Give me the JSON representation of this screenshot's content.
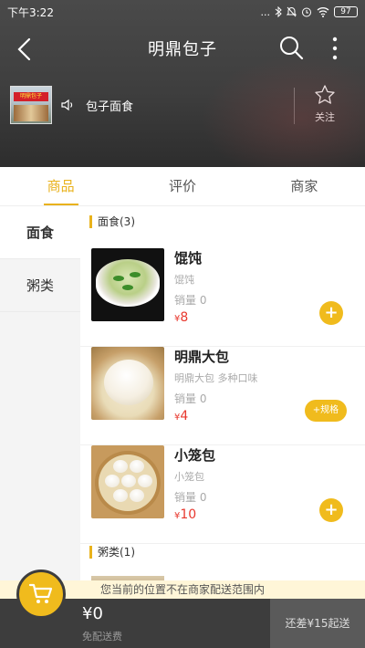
{
  "status_bar": {
    "time": "下午3:22",
    "signal": "...",
    "battery": "97"
  },
  "navbar": {
    "title": "明鼎包子"
  },
  "store": {
    "sign_text": "明鼎包子",
    "notice": "包子面食",
    "follow_label": "关注"
  },
  "tabs": [
    {
      "label": "商品",
      "active": true
    },
    {
      "label": "评价",
      "active": false
    },
    {
      "label": "商家",
      "active": false
    }
  ],
  "categories": [
    {
      "label": "面食",
      "active": true
    },
    {
      "label": "粥类",
      "active": false
    }
  ],
  "sections": [
    {
      "title": "面食(3)"
    },
    {
      "title": "粥类(1)"
    }
  ],
  "products": [
    {
      "name": "馄饨",
      "desc": "馄饨",
      "sales": "销量 0",
      "currency": "¥",
      "price": "8",
      "action": "+"
    },
    {
      "name": "明鼎大包",
      "desc": "明鼎大包  多种口味",
      "sales": "销量 0",
      "currency": "¥",
      "price": "4",
      "action": "+规格"
    },
    {
      "name": "小笼包",
      "desc": "小笼包",
      "sales": "销量 0",
      "currency": "¥",
      "price": "10",
      "action": "+"
    }
  ],
  "footer": {
    "out_of_range": "您当前的位置不在商家配送范围内",
    "total": "¥0",
    "delivery": "免配送费",
    "checkout": "还差¥15起送"
  },
  "colors": {
    "accent": "#f0bb1d",
    "price": "#e8382e",
    "header": "#3e3e3e",
    "bottom_bar": "#3d3d3d"
  },
  "icons": [
    "back-icon",
    "search-icon",
    "more-icon",
    "speaker-icon",
    "star-icon",
    "cart-icon",
    "wifi-icon",
    "battery-icon"
  ]
}
